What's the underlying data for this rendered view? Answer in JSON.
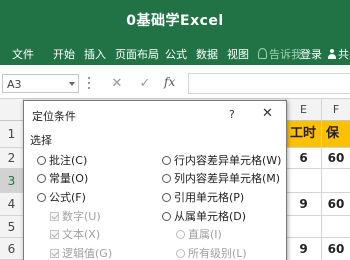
{
  "window": {
    "title": "0基础学Excel"
  },
  "ribbon": {
    "tabs": [
      "文件",
      "开始",
      "插入",
      "页面布局",
      "公式",
      "数据",
      "视图"
    ],
    "tell_me": "告诉我",
    "login": "登录",
    "share": "共"
  },
  "formula_bar": {
    "name_box": "A3",
    "cancel_icon": "✕",
    "enter_icon": "✓",
    "fx": "fx",
    "value": ""
  },
  "grid": {
    "columns": [
      "E",
      "F"
    ],
    "rows": [
      "1",
      "2",
      "3",
      "4",
      "5",
      "6"
    ],
    "selected_row": "3",
    "header_cells": [
      "工时",
      "保险"
    ],
    "values": [
      [
        "6",
        "60"
      ],
      [
        "",
        ""
      ],
      [
        "9",
        "60"
      ],
      [
        "",
        ""
      ],
      [
        "9",
        "60"
      ]
    ]
  },
  "dialog": {
    "title": "定位条件",
    "help": "?",
    "close": "✕",
    "group_label": "选择",
    "left_options": [
      {
        "label": "批注(C)",
        "kind": "radio",
        "enabled": true
      },
      {
        "label": "常量(O)",
        "kind": "radio",
        "enabled": true
      },
      {
        "label": "公式(F)",
        "kind": "radio",
        "enabled": true
      },
      {
        "label": "数字(U)",
        "kind": "check",
        "enabled": false
      },
      {
        "label": "文本(X)",
        "kind": "check",
        "enabled": false
      },
      {
        "label": "逻辑值(G)",
        "kind": "check",
        "enabled": false
      }
    ],
    "right_options": [
      {
        "label": "行内容差异单元格(W)",
        "kind": "radio",
        "enabled": true
      },
      {
        "label": "列内容差异单元格(M)",
        "kind": "radio",
        "enabled": true
      },
      {
        "label": "引用单元格(P)",
        "kind": "radio",
        "enabled": true
      },
      {
        "label": "从属单元格(D)",
        "kind": "radio",
        "enabled": true
      },
      {
        "label": "直属(I)",
        "kind": "radio",
        "enabled": false
      },
      {
        "label": "所有级别(L)",
        "kind": "radio",
        "enabled": false
      }
    ]
  },
  "colors": {
    "excel_green": "#217346",
    "header_fill": "#ffc000"
  }
}
